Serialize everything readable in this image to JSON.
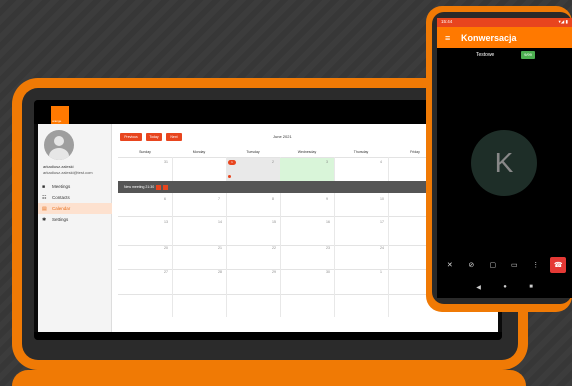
{
  "tablet": {
    "logo_text": "orange",
    "user": {
      "name": "arkadiusz.zaleski",
      "email": "arkadiusz.zaleski@test.com"
    },
    "nav": [
      {
        "label": "Meetings",
        "icon": "video-icon"
      },
      {
        "label": "Contacts",
        "icon": "contacts-icon"
      },
      {
        "label": "Calendar",
        "icon": "calendar-icon",
        "active": true
      },
      {
        "label": "Settings",
        "icon": "gear-icon"
      }
    ],
    "calendar": {
      "buttons": {
        "previous": "Previous",
        "today": "Today",
        "next": "Next",
        "new": "New"
      },
      "month_title": "June 2021",
      "days": [
        "Sunday",
        "Monday",
        "Tuesday",
        "Wednesday",
        "Thursday",
        "Friday"
      ],
      "week1": [
        "31",
        "1",
        "2",
        "3",
        "4"
      ],
      "week2": [
        "6",
        "7",
        "8",
        "9",
        "10"
      ],
      "week3": [
        "13",
        "14",
        "15",
        "16",
        "17"
      ],
      "week4": [
        "20",
        "21",
        "22",
        "23",
        "24"
      ],
      "week5": [
        "27",
        "28",
        "29",
        "30",
        "1"
      ],
      "event": {
        "label": "New meeting 21:30"
      },
      "accent": "#e8451e"
    }
  },
  "phone": {
    "status_time": "15:44",
    "status_icons": "▾◢ ▮",
    "title": "Konwersacja",
    "participant": "Testowe",
    "badge": "9/99",
    "avatar_letter": "K",
    "controls": [
      {
        "icon": "mic-off-icon"
      },
      {
        "icon": "camera-off-icon"
      },
      {
        "icon": "chat-icon"
      },
      {
        "icon": "share-screen-icon"
      },
      {
        "icon": "more-icon"
      }
    ],
    "hangup_icon": "hangup-icon",
    "brand_color": "#ff7900"
  }
}
